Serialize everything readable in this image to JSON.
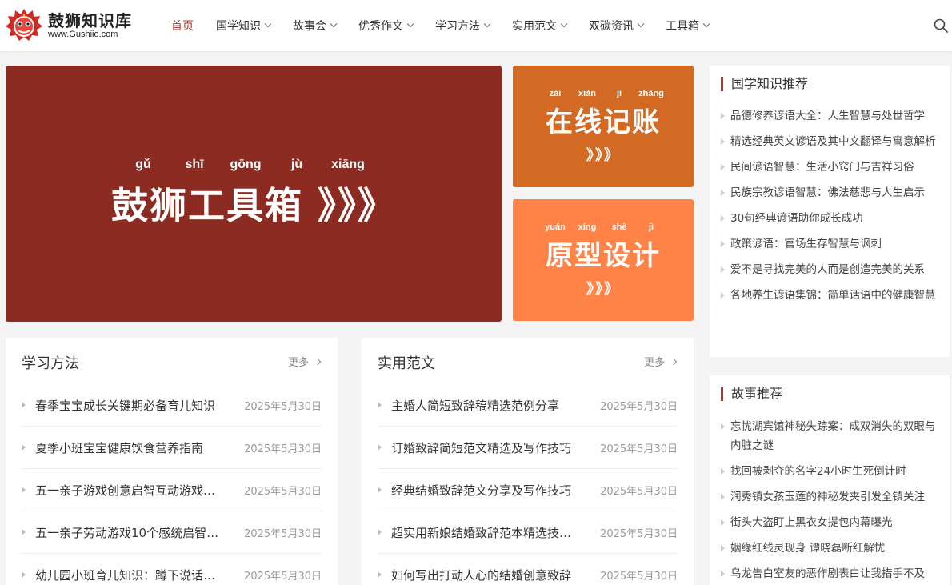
{
  "header": {
    "logo_title": "鼓狮知识库",
    "logo_sub": "www.Gushiio.com",
    "nav": [
      {
        "label": "首页",
        "active": true,
        "dropdown": false
      },
      {
        "label": "国学知识",
        "active": false,
        "dropdown": true
      },
      {
        "label": "故事会",
        "active": false,
        "dropdown": true
      },
      {
        "label": "优秀作文",
        "active": false,
        "dropdown": true
      },
      {
        "label": "学习方法",
        "active": false,
        "dropdown": true
      },
      {
        "label": "实用范文",
        "active": false,
        "dropdown": true
      },
      {
        "label": "双碳资讯",
        "active": false,
        "dropdown": true
      },
      {
        "label": "工具箱",
        "active": false,
        "dropdown": true
      }
    ],
    "search_icon": "search-icon"
  },
  "banners": {
    "main": {
      "pinyin": [
        "gǔ",
        "shī",
        "gōng",
        "jù",
        "xiāng"
      ],
      "title": "鼓狮工具箱 》》》",
      "bg": "#8b2b22"
    },
    "side1": {
      "pinyin": [
        "zài",
        "xiàn",
        "jì",
        "zhàng"
      ],
      "title": "在线记账",
      "arrows": "》》》",
      "bg": "#d26a24"
    },
    "side2": {
      "pinyin": [
        "yuán",
        "xíng",
        "shè",
        "jì"
      ],
      "title": "原型设计",
      "arrows": "》》》",
      "bg": "#ff8247"
    }
  },
  "panels": [
    {
      "title": "学习方法",
      "more": "更多",
      "items": [
        {
          "title": "春季宝宝成长关键期必备育儿知识",
          "date": "2025年5月30日"
        },
        {
          "title": "夏季小班宝宝健康饮食营养指南",
          "date": "2025年5月30日"
        },
        {
          "title": "五一亲子游戏创意启智互动游戏…",
          "date": "2025年5月30日"
        },
        {
          "title": "五一亲子劳动游戏10个感统启智…",
          "date": "2025年5月30日"
        },
        {
          "title": "幼儿园小班育儿知识：蹲下说话…",
          "date": "2025年5月30日"
        }
      ]
    },
    {
      "title": "实用范文",
      "more": "更多",
      "items": [
        {
          "title": "主婚人简短致辞稿精选范例分享",
          "date": "2025年5月30日"
        },
        {
          "title": "订婚致辞简短范文精选及写作技巧",
          "date": "2025年5月30日"
        },
        {
          "title": "经典结婚致辞范文分享及写作技巧",
          "date": "2025年5月30日"
        },
        {
          "title": "超实用新娘结婚致辞范本精选技…",
          "date": "2025年5月30日"
        },
        {
          "title": "如何写出打动人心的结婚创意致辞",
          "date": "2025年5月30日"
        }
      ]
    }
  ],
  "sidebar": [
    {
      "title": "国学知识推荐",
      "items": [
        "品德修养谚语大全：人生智慧与处世哲学",
        "精选经典英文谚语及其中文翻译与寓意解析",
        "民间谚语智慧：生活小窍门与吉祥习俗",
        "民族宗教谚语智慧：佛法慈悲与人生启示",
        "30句经典谚语助你成长成功",
        "政策谚语：官场生存智慧与讽刺",
        "爱不是寻找完美的人而是创造完美的关系",
        "各地养生谚语集锦：简单话语中的健康智慧"
      ]
    },
    {
      "title": "故事推荐",
      "items": [
        "忘忧湖宾馆神秘失踪案：成双消失的双眼与内脏之谜",
        "找回被剥夺的名字24小时生死倒计时",
        "润秀镇女孩玉莲的神秘发夹引发全镇关注",
        "街头大盗盯上黑衣女提包内幕曝光",
        "姻缘红线灵现身 谭晓磊断红解忧",
        "乌龙告白室友的恶作剧表白让我措手不及"
      ]
    }
  ],
  "colors": {
    "accent": "#b5312c"
  }
}
